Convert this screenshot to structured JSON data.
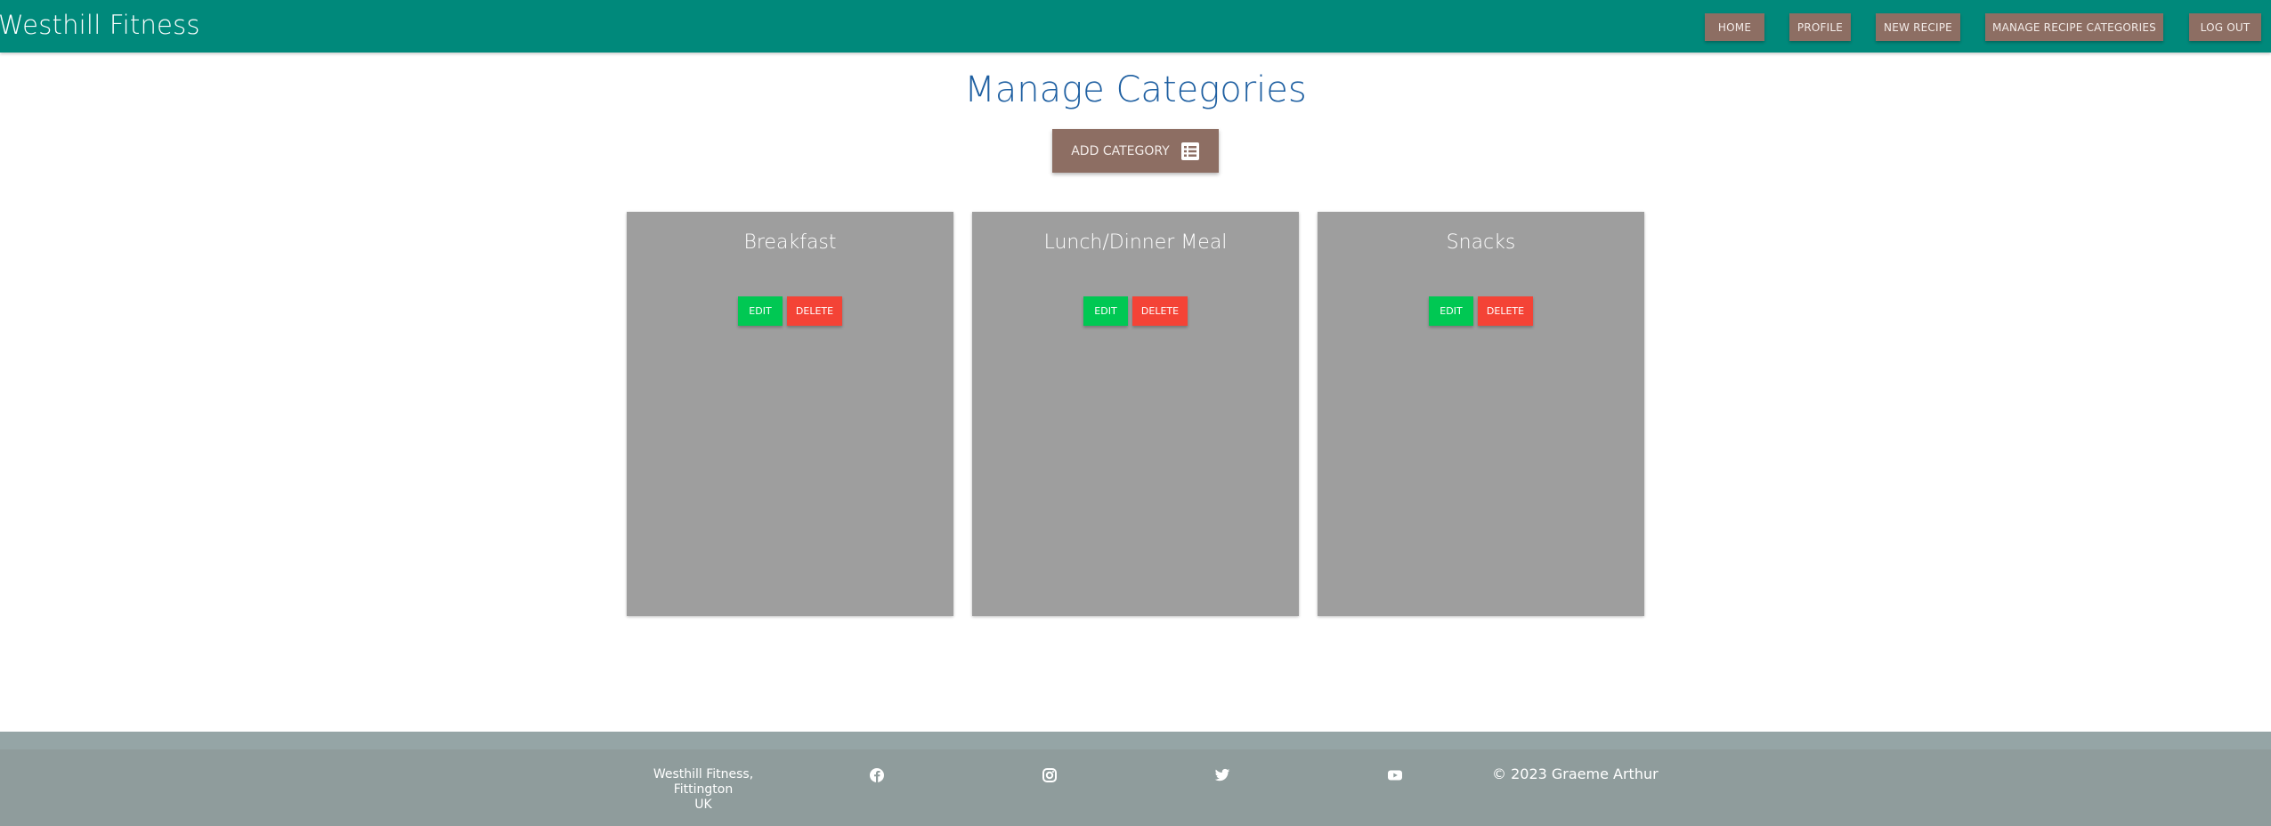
{
  "navbar": {
    "brand": "Westhill Fitness",
    "links": [
      {
        "label": "HOME"
      },
      {
        "label": "PROFILE"
      },
      {
        "label": "NEW RECIPE"
      },
      {
        "label": "MANAGE RECIPE CATEGORIES"
      },
      {
        "label": "LOG OUT"
      }
    ],
    "colors": {
      "bar": "#00897b",
      "button": "#8d6e63"
    }
  },
  "main": {
    "title": "Manage Categories",
    "add_button": {
      "label": "ADD CATEGORY",
      "icon": "list-icon"
    },
    "categories": [
      {
        "name": "Breakfast",
        "edit_label": "EDIT",
        "delete_label": "DELETE"
      },
      {
        "name": "Lunch/Dinner Meal",
        "edit_label": "EDIT",
        "delete_label": "DELETE"
      },
      {
        "name": "Snacks",
        "edit_label": "EDIT",
        "delete_label": "DELETE"
      }
    ],
    "colors": {
      "card": "#9e9e9e",
      "edit": "#00c853",
      "delete": "#f44336",
      "title": "#1e5fa1"
    }
  },
  "footer": {
    "address_line1": "Westhill Fitness, Fittington",
    "address_line2": "UK",
    "social": [
      {
        "icon": "facebook-icon"
      },
      {
        "icon": "instagram-icon"
      },
      {
        "icon": "twitter-icon"
      },
      {
        "icon": "youtube-icon"
      }
    ],
    "copyright": "© 2023 Graeme Arthur"
  }
}
